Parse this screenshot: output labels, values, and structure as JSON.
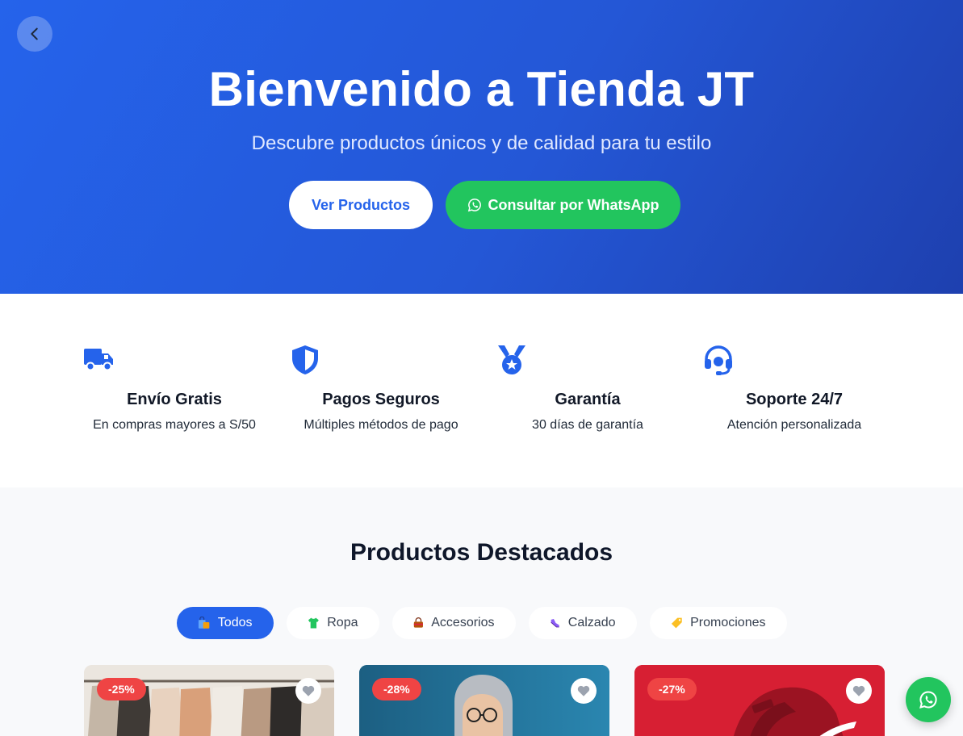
{
  "hero": {
    "title": "Bienvenido a Tienda JT",
    "subtitle": "Descubre productos únicos y de calidad para tu estilo",
    "primary_button": "Ver Productos",
    "whatsapp_button": "Consultar por WhatsApp",
    "back_icon": "chevron-left-icon"
  },
  "features": [
    {
      "icon": "truck-icon",
      "title": "Envío Gratis",
      "desc": "En compras mayores a S/50"
    },
    {
      "icon": "shield-icon",
      "title": "Pagos Seguros",
      "desc": "Múltiples métodos de pago"
    },
    {
      "icon": "medal-icon",
      "title": "Garantía",
      "desc": "30 días de garantía"
    },
    {
      "icon": "headset-icon",
      "title": "Soporte 24/7",
      "desc": "Atención personalizada"
    }
  ],
  "products_section": {
    "title": "Productos Destacados",
    "filters": [
      {
        "label": "Todos",
        "icon": "shopping-bags-icon",
        "active": true
      },
      {
        "label": "Ropa",
        "icon": "tshirt-icon",
        "active": false
      },
      {
        "label": "Accesorios",
        "icon": "handbag-icon",
        "active": false
      },
      {
        "label": "Calzado",
        "icon": "sneaker-icon",
        "active": false
      },
      {
        "label": "Promociones",
        "icon": "tag-icon",
        "active": false
      }
    ],
    "products": [
      {
        "discount": "-25%",
        "image": "clothing-rack-photo"
      },
      {
        "discount": "-28%",
        "image": "hooded-person-photo"
      },
      {
        "discount": "-27%",
        "image": "red-sneaker-photo"
      }
    ]
  },
  "colors": {
    "primary": "#2563eb",
    "whatsapp": "#22c55e",
    "discount": "#ef4444"
  }
}
